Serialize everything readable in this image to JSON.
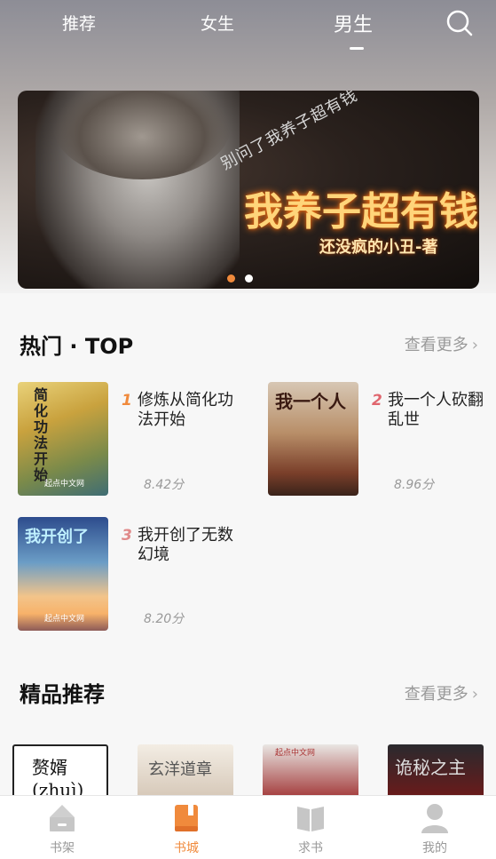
{
  "top_tabs": [
    {
      "label": "推荐"
    },
    {
      "label": "女生"
    },
    {
      "label": "男生"
    }
  ],
  "active_tab": "男生",
  "banner": {
    "subtitle": "别问了我养子超有钱",
    "title": "我养子超有钱",
    "author": "还没疯的小丑-著",
    "slides": 2,
    "active_slide": 1
  },
  "hot": {
    "title": "热门 · TOP",
    "more": "查看更多",
    "books": [
      {
        "rank": "1",
        "name": "修炼从简化功法开始",
        "score": "8.42分",
        "cover_text": "简化功法开始",
        "publisher": "起点中文网"
      },
      {
        "rank": "2",
        "name": "我一个人砍翻乱世",
        "score": "8.96分",
        "cover_text": "我一个人",
        "publisher": ""
      },
      {
        "rank": "3",
        "name": "我开创了无数幻境",
        "score": "8.20分",
        "cover_text": "我开创了",
        "publisher": "起点中文网"
      }
    ]
  },
  "recommend": {
    "title": "精品推荐",
    "more": "查看更多",
    "covers": [
      {
        "text": "赘婿 (zhuì)"
      },
      {
        "text": "玄洋道章"
      },
      {
        "text": "起点中文网"
      },
      {
        "text": "诡秘之主"
      }
    ]
  },
  "nav": [
    {
      "label": "书架",
      "icon": "bookshelf-icon"
    },
    {
      "label": "书城",
      "icon": "bookstore-icon"
    },
    {
      "label": "求书",
      "icon": "open-book-icon"
    },
    {
      "label": "我的",
      "icon": "profile-icon"
    }
  ],
  "colors": {
    "accent": "#f08a3c",
    "rank1": "#f08a3c",
    "rank2": "#e0666e",
    "rank3": "#e08a8a"
  }
}
